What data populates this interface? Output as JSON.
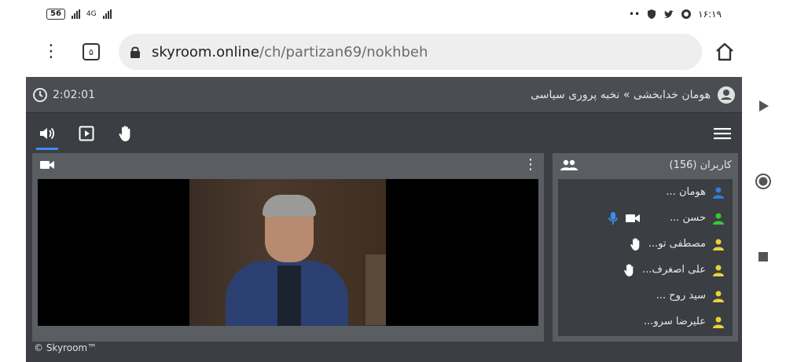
{
  "status_bar": {
    "battery": "56",
    "network": "4G",
    "time": "۱۶:۱۹",
    "notifications": "••"
  },
  "browser": {
    "tab_count": "۵",
    "url_host": "skyroom.online",
    "url_path": "/ch/partizan69/nokhbeh"
  },
  "app": {
    "timer": "2:02:01",
    "breadcrumb": "هومان خدابخشی » نخبه پروری سیاسی",
    "users_title": "کاربران (156)",
    "footer": "© Skyroom™",
    "colors": {
      "background": "#3b3e42",
      "panel": "#5a5d62",
      "accent": "#3d8ef0",
      "presenter": "#2f7fd6",
      "speaker": "#37c837",
      "listener": "#e8d33a"
    },
    "users": [
      {
        "name": "هومان ...",
        "role": "presenter",
        "raised_hand": false,
        "media": false
      },
      {
        "name": "حسن ...",
        "role": "speaker",
        "raised_hand": false,
        "media": true
      },
      {
        "name": "مصطفی تو...",
        "role": "listener",
        "raised_hand": true,
        "media": false
      },
      {
        "name": "علی اصغرف...",
        "role": "listener",
        "raised_hand": true,
        "media": false
      },
      {
        "name": "سید روح ...",
        "role": "listener",
        "raised_hand": false,
        "media": false
      },
      {
        "name": "علیرضا سرو...",
        "role": "listener",
        "raised_hand": false,
        "media": false
      }
    ]
  }
}
